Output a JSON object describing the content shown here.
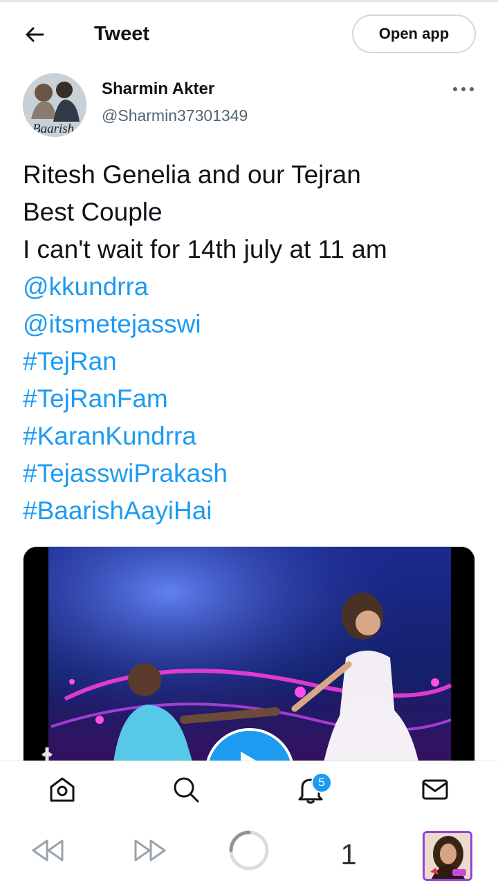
{
  "header": {
    "title": "Tweet",
    "open_app_label": "Open app"
  },
  "author": {
    "name": "Sharmin Akter",
    "handle": "@Sharmin37301349",
    "avatar_caption": "Baarish"
  },
  "tweet": {
    "lines": [
      {
        "text": "Ritesh Genelia and our Tejran",
        "type": "text"
      },
      {
        "text": "Best Couple",
        "type": "text"
      },
      {
        "text": "I can't wait for 14th july at 11 am",
        "type": "text"
      },
      {
        "text": "@kkundrra",
        "type": "mention"
      },
      {
        "text": "@itsmetejasswi",
        "type": "mention"
      },
      {
        "text": "#TejRan",
        "type": "hashtag"
      },
      {
        "text": "#TejRanFam",
        "type": "hashtag"
      },
      {
        "text": "#KaranKundrra",
        "type": "hashtag"
      },
      {
        "text": "#TejasswiPrakash",
        "type": "hashtag"
      },
      {
        "text": "#BaarishAayiHai",
        "type": "hashtag"
      }
    ]
  },
  "media": {
    "type": "video",
    "play_icon": "play-icon",
    "watermark_icon": "tiktok-icon"
  },
  "bottom_nav": {
    "items": [
      {
        "name": "home",
        "icon": "home-icon"
      },
      {
        "name": "search",
        "icon": "search-icon"
      },
      {
        "name": "notifications",
        "icon": "bell-icon"
      },
      {
        "name": "messages",
        "icon": "mail-icon"
      }
    ],
    "notification_count": "5"
  },
  "browser_bar": {
    "tab_count": "1"
  },
  "colors": {
    "accent": "#1d9bf0",
    "text": "#0f1419",
    "secondary_text": "#536471",
    "thumbnail_border": "#9b3fd1"
  }
}
